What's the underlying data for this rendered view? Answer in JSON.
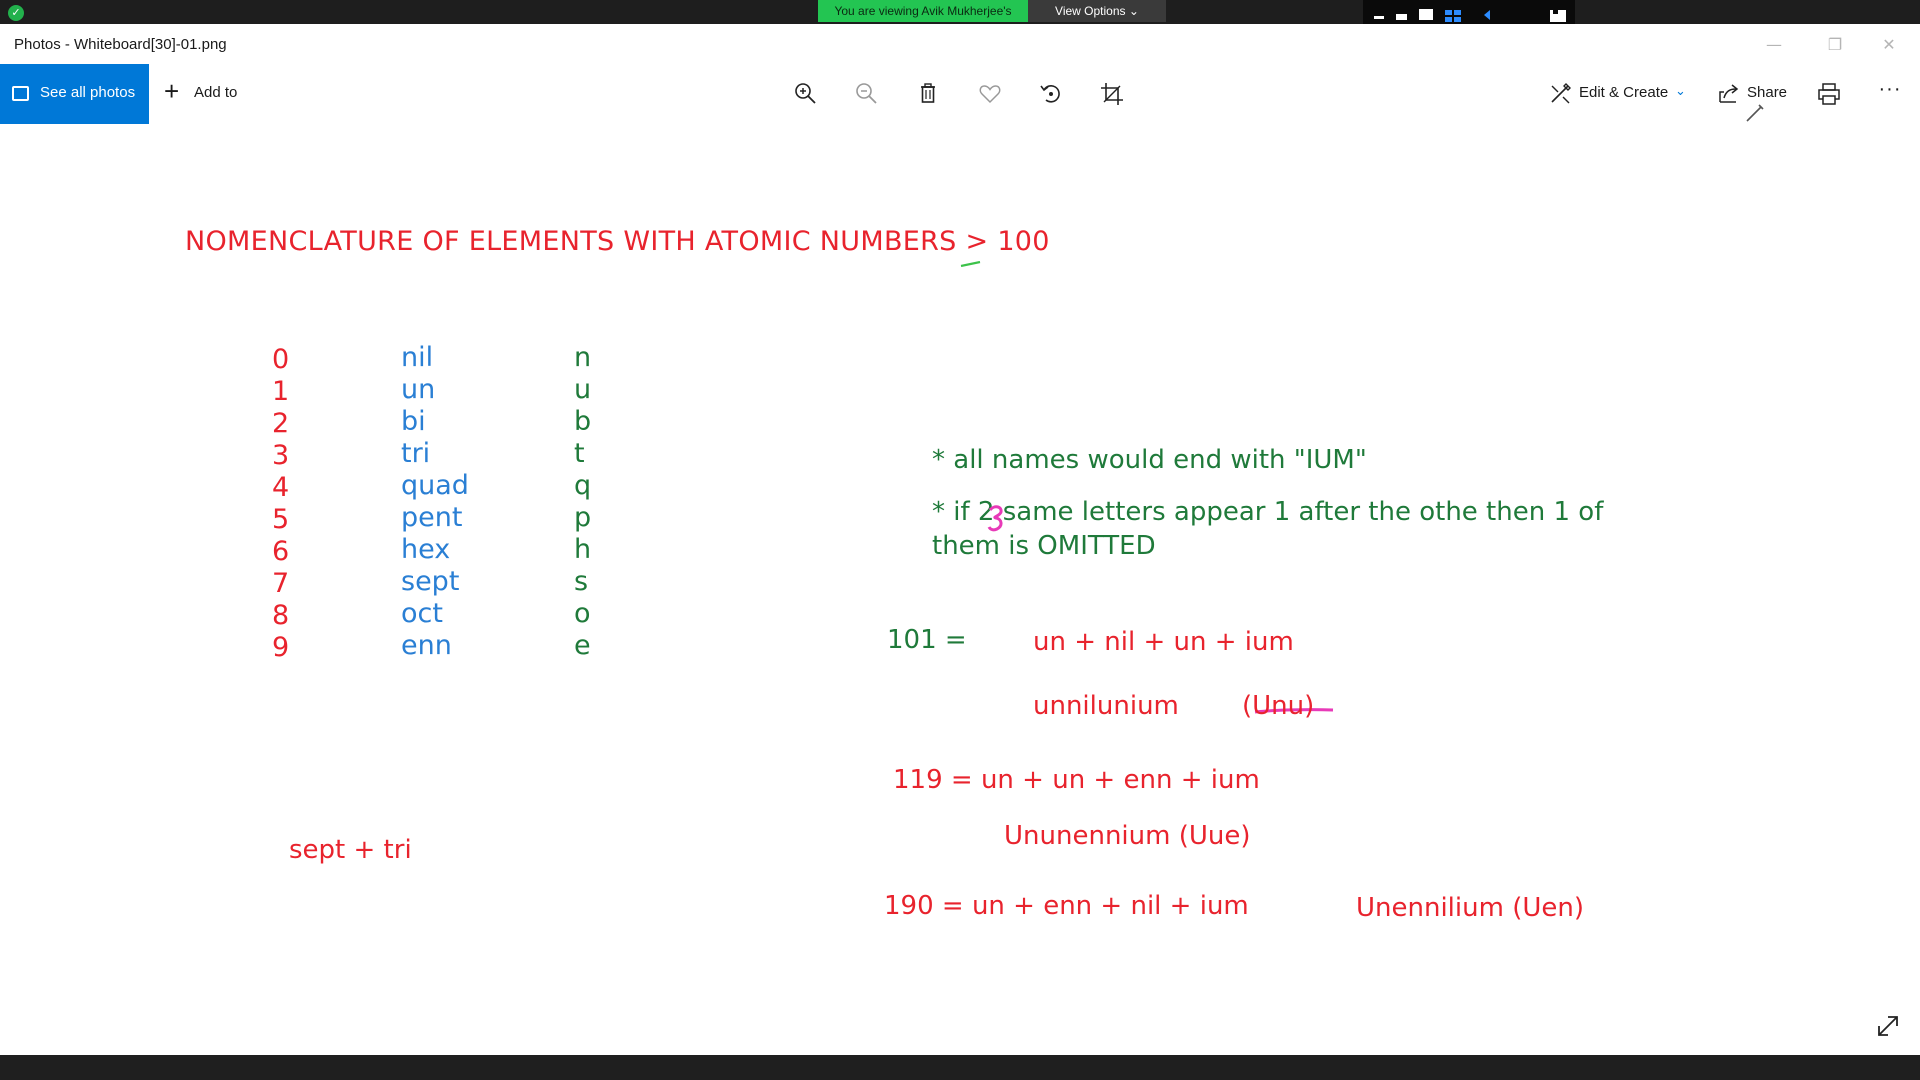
{
  "zoom": {
    "banner_text": "You are viewing Avik Mukherjee's screen",
    "view_options_label": "View Options"
  },
  "window": {
    "title": "Photos - Whiteboard[30]-01.png"
  },
  "toolbar": {
    "see_all_label": "See all photos",
    "add_to_label": "Add to",
    "edit_create_label": "Edit & Create",
    "share_label": "Share",
    "more_label": "···"
  },
  "whiteboard": {
    "heading": "NOMENCLATURE OF ELEMENTS WITH ATOMIC NUMBERS > 100",
    "digits": [
      "0",
      "1",
      "2",
      "3",
      "4",
      "5",
      "6",
      "7",
      "8",
      "9"
    ],
    "roots": [
      "nil",
      "un",
      "bi",
      "tri",
      "quad",
      "pent",
      "hex",
      "sept",
      "oct",
      "enn"
    ],
    "symbols": [
      "n",
      "u",
      "b",
      "t",
      "q",
      "p",
      "h",
      "s",
      "o",
      "e"
    ],
    "rule_1": "* all names would end with \"IUM\"",
    "rule_2_line1": "* if 2 same letters appear 1 after the othe then 1 of",
    "rule_2_line2": "them is OMITTED",
    "ex101_lhs": "101 =",
    "ex101_rhs": "un + nil + un + ium",
    "ex101_name": "unnilunium",
    "ex101_symbol": "(Unu)",
    "ex119_eq": "119 = un + un + enn + ium",
    "ex119_name": "Ununennium (Uue)",
    "ex190_eq": "190 = un + enn + nil + ium",
    "ex190_name": "Unennilium (Uen)",
    "scribble": "sept + tri"
  },
  "colors": {
    "accent": "#0078d7",
    "zoom_green": "#23c552",
    "ink_red": "#e8232d",
    "ink_blue": "#2a7fd4",
    "ink_green": "#1f7a3a",
    "ink_magenta": "#e83ab8"
  }
}
